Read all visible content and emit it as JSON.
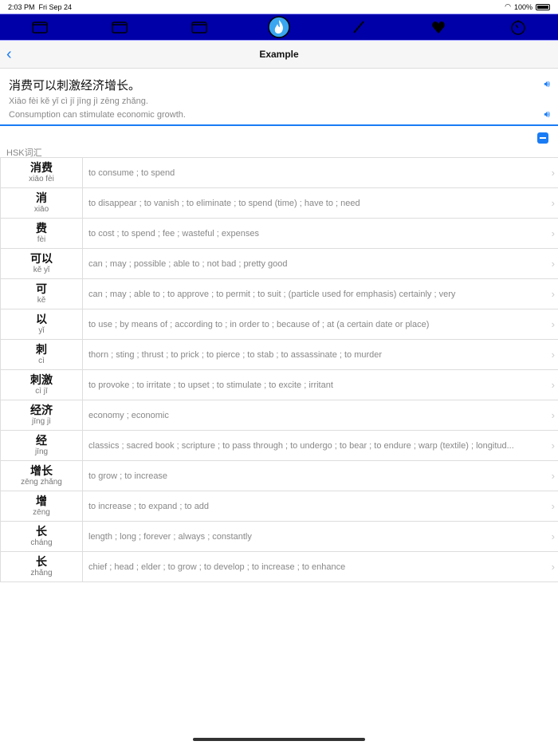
{
  "status": {
    "time": "2:03 PM",
    "date": "Fri Sep 24",
    "battery": "100%",
    "battery_level": 1.0
  },
  "toolbar": {
    "icons": [
      "folder-icon",
      "folder-icon",
      "folder-icon",
      "flame-icon",
      "pencil-icon",
      "heart-icon",
      "timer-icon"
    ],
    "active": "flame-icon",
    "background": "#0000a8"
  },
  "nav": {
    "title": "Example"
  },
  "example": {
    "hanzi": "消费可以刺激经济增长。",
    "pinyin": "Xiāo fèi kě yǐ cì jī jīng jì zēng zhǎng.",
    "english": "Consumption can stimulate economic growth."
  },
  "section": {
    "label": "HSK词汇"
  },
  "words": [
    {
      "hanzi": "消费",
      "pinyin": "xiāo fèi",
      "def": "to consume ; to spend"
    },
    {
      "hanzi": "消",
      "pinyin": "xiāo",
      "def": "to disappear ; to vanish ; to eliminate ; to spend (time) ; have to ; need"
    },
    {
      "hanzi": "费",
      "pinyin": "fèi",
      "def": "to cost ; to spend ; fee ; wasteful ; expenses"
    },
    {
      "hanzi": "可以",
      "pinyin": "kě yǐ",
      "def": "can ; may ; possible ; able to ; not bad ; pretty good"
    },
    {
      "hanzi": "可",
      "pinyin": "kě",
      "def": "can ; may ; able to ; to approve ; to permit ; to suit ; (particle used for emphasis) certainly ; very"
    },
    {
      "hanzi": "以",
      "pinyin": "yǐ",
      "def": "to use ; by means of ; according to ; in order to ; because of ; at (a certain date or place)"
    },
    {
      "hanzi": "刺",
      "pinyin": "cì",
      "def": "thorn ; sting ; thrust ; to prick ; to pierce ; to stab ; to assassinate ; to murder"
    },
    {
      "hanzi": "刺激",
      "pinyin": "cì jī",
      "def": "to provoke ; to irritate ; to upset ; to stimulate ; to excite ; irritant"
    },
    {
      "hanzi": "经济",
      "pinyin": "jīng jì",
      "def": "economy ; economic"
    },
    {
      "hanzi": "经",
      "pinyin": "jīng",
      "def": "classics ; sacred book ; scripture ; to pass through ; to undergo ; to bear ; to endure ; warp (textile) ; longitud..."
    },
    {
      "hanzi": "增长",
      "pinyin": "zēng zhǎng",
      "def": "to grow ; to increase"
    },
    {
      "hanzi": "增",
      "pinyin": "zēng",
      "def": "to increase ; to expand ; to add"
    },
    {
      "hanzi": "长",
      "pinyin": "cháng",
      "def": "length ; long ; forever ; always ; constantly"
    },
    {
      "hanzi": "长",
      "pinyin": "zhǎng",
      "def": "chief ; head ; elder ; to grow ; to develop ; to increase ; to enhance"
    }
  ]
}
